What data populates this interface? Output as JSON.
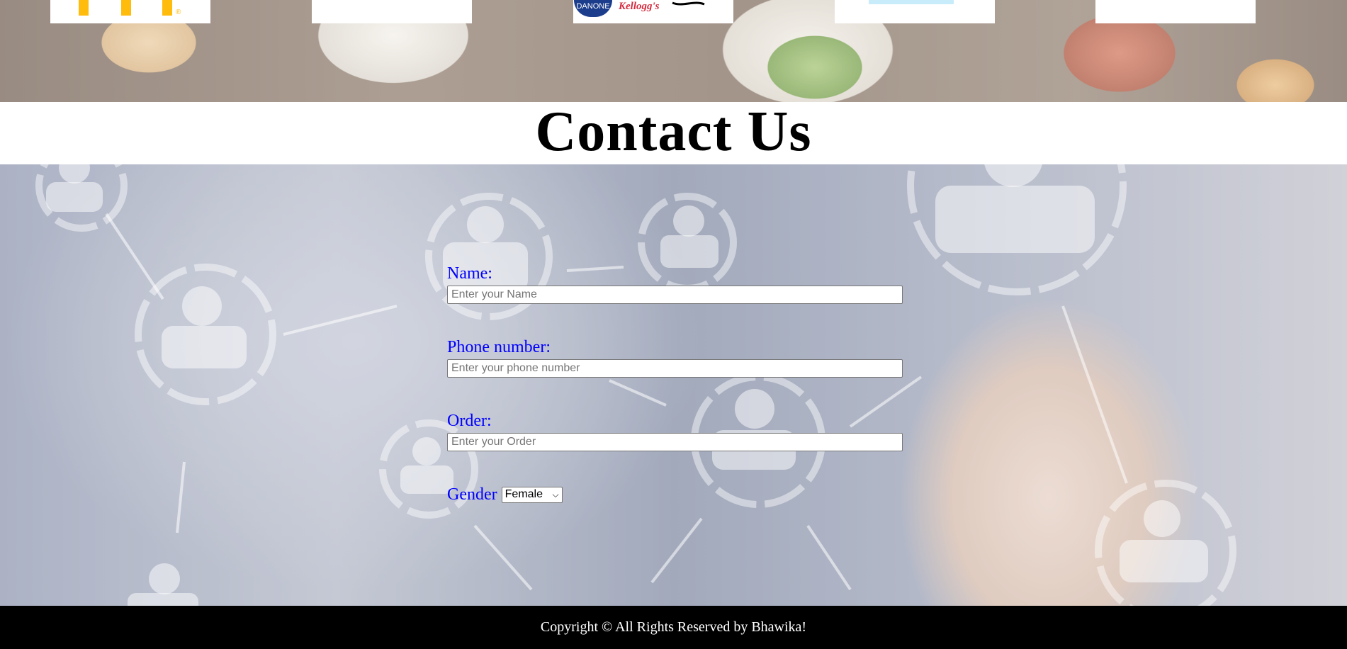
{
  "banner": {
    "logos": [
      "mcdonalds-logo",
      "blank-logo",
      "danone-kelloggs-logo",
      "blank-logo",
      "blank-logo"
    ],
    "danone_text": "DANONE",
    "kelloggs_text": "Kellogg's",
    "reg_mark": "®"
  },
  "page": {
    "title": "Contact Us"
  },
  "form": {
    "name_label": "Name:",
    "name_placeholder": "Enter your Name",
    "phone_label": "Phone number:",
    "phone_placeholder": "Enter your phone number",
    "order_label": "Order:",
    "order_placeholder": "Enter your Order",
    "gender_label": "Gender",
    "gender_selected": "Female",
    "gender_options": [
      "Female"
    ]
  },
  "footer": {
    "copyright": "Copyright © All Rights Reserved by Bhawika!"
  },
  "colors": {
    "label_color": "#0000ff",
    "footer_bg": "#000000",
    "mcdonalds_yellow": "#ffbc0d"
  }
}
